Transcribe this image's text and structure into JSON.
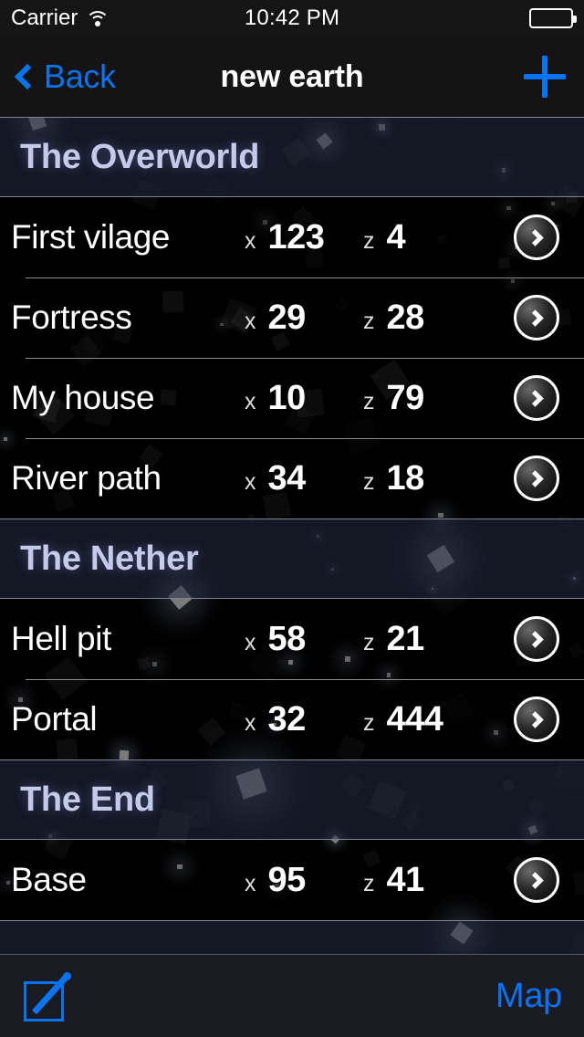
{
  "status_bar": {
    "carrier": "Carrier",
    "wifi_icon": "wifi-icon",
    "time": "10:42 PM",
    "battery_icon": "battery-full-icon"
  },
  "nav_bar": {
    "back_label": "Back",
    "back_icon": "chevron-left-icon",
    "title": "new earth",
    "add_icon": "plus-icon"
  },
  "accent_color": "#0a74f0",
  "section_title_color": "#c4cbe8",
  "sections": [
    {
      "title": "The Overworld",
      "rows": [
        {
          "name": "First vilage",
          "x_label": "x",
          "x": "123",
          "z_label": "z",
          "z": "4",
          "disclosure_icon": "chevron-right-circle-icon"
        },
        {
          "name": "Fortress",
          "x_label": "x",
          "x": "29",
          "z_label": "z",
          "z": "28",
          "disclosure_icon": "chevron-right-circle-icon"
        },
        {
          "name": "My house",
          "x_label": "x",
          "x": "10",
          "z_label": "z",
          "z": "79",
          "disclosure_icon": "chevron-right-circle-icon"
        },
        {
          "name": "River path",
          "x_label": "x",
          "x": "34",
          "z_label": "z",
          "z": "18",
          "disclosure_icon": "chevron-right-circle-icon"
        }
      ]
    },
    {
      "title": "The Nether",
      "rows": [
        {
          "name": "Hell pit",
          "x_label": "x",
          "x": "58",
          "z_label": "z",
          "z": "21",
          "disclosure_icon": "chevron-right-circle-icon"
        },
        {
          "name": "Portal",
          "x_label": "x",
          "x": "32",
          "z_label": "z",
          "z": "444",
          "disclosure_icon": "chevron-right-circle-icon"
        }
      ]
    },
    {
      "title": "The End",
      "rows": [
        {
          "name": "Base",
          "x_label": "x",
          "x": "95",
          "z_label": "z",
          "z": "41",
          "disclosure_icon": "chevron-right-circle-icon"
        }
      ]
    }
  ],
  "toolbar": {
    "compose_icon": "compose-icon",
    "map_label": "Map"
  }
}
